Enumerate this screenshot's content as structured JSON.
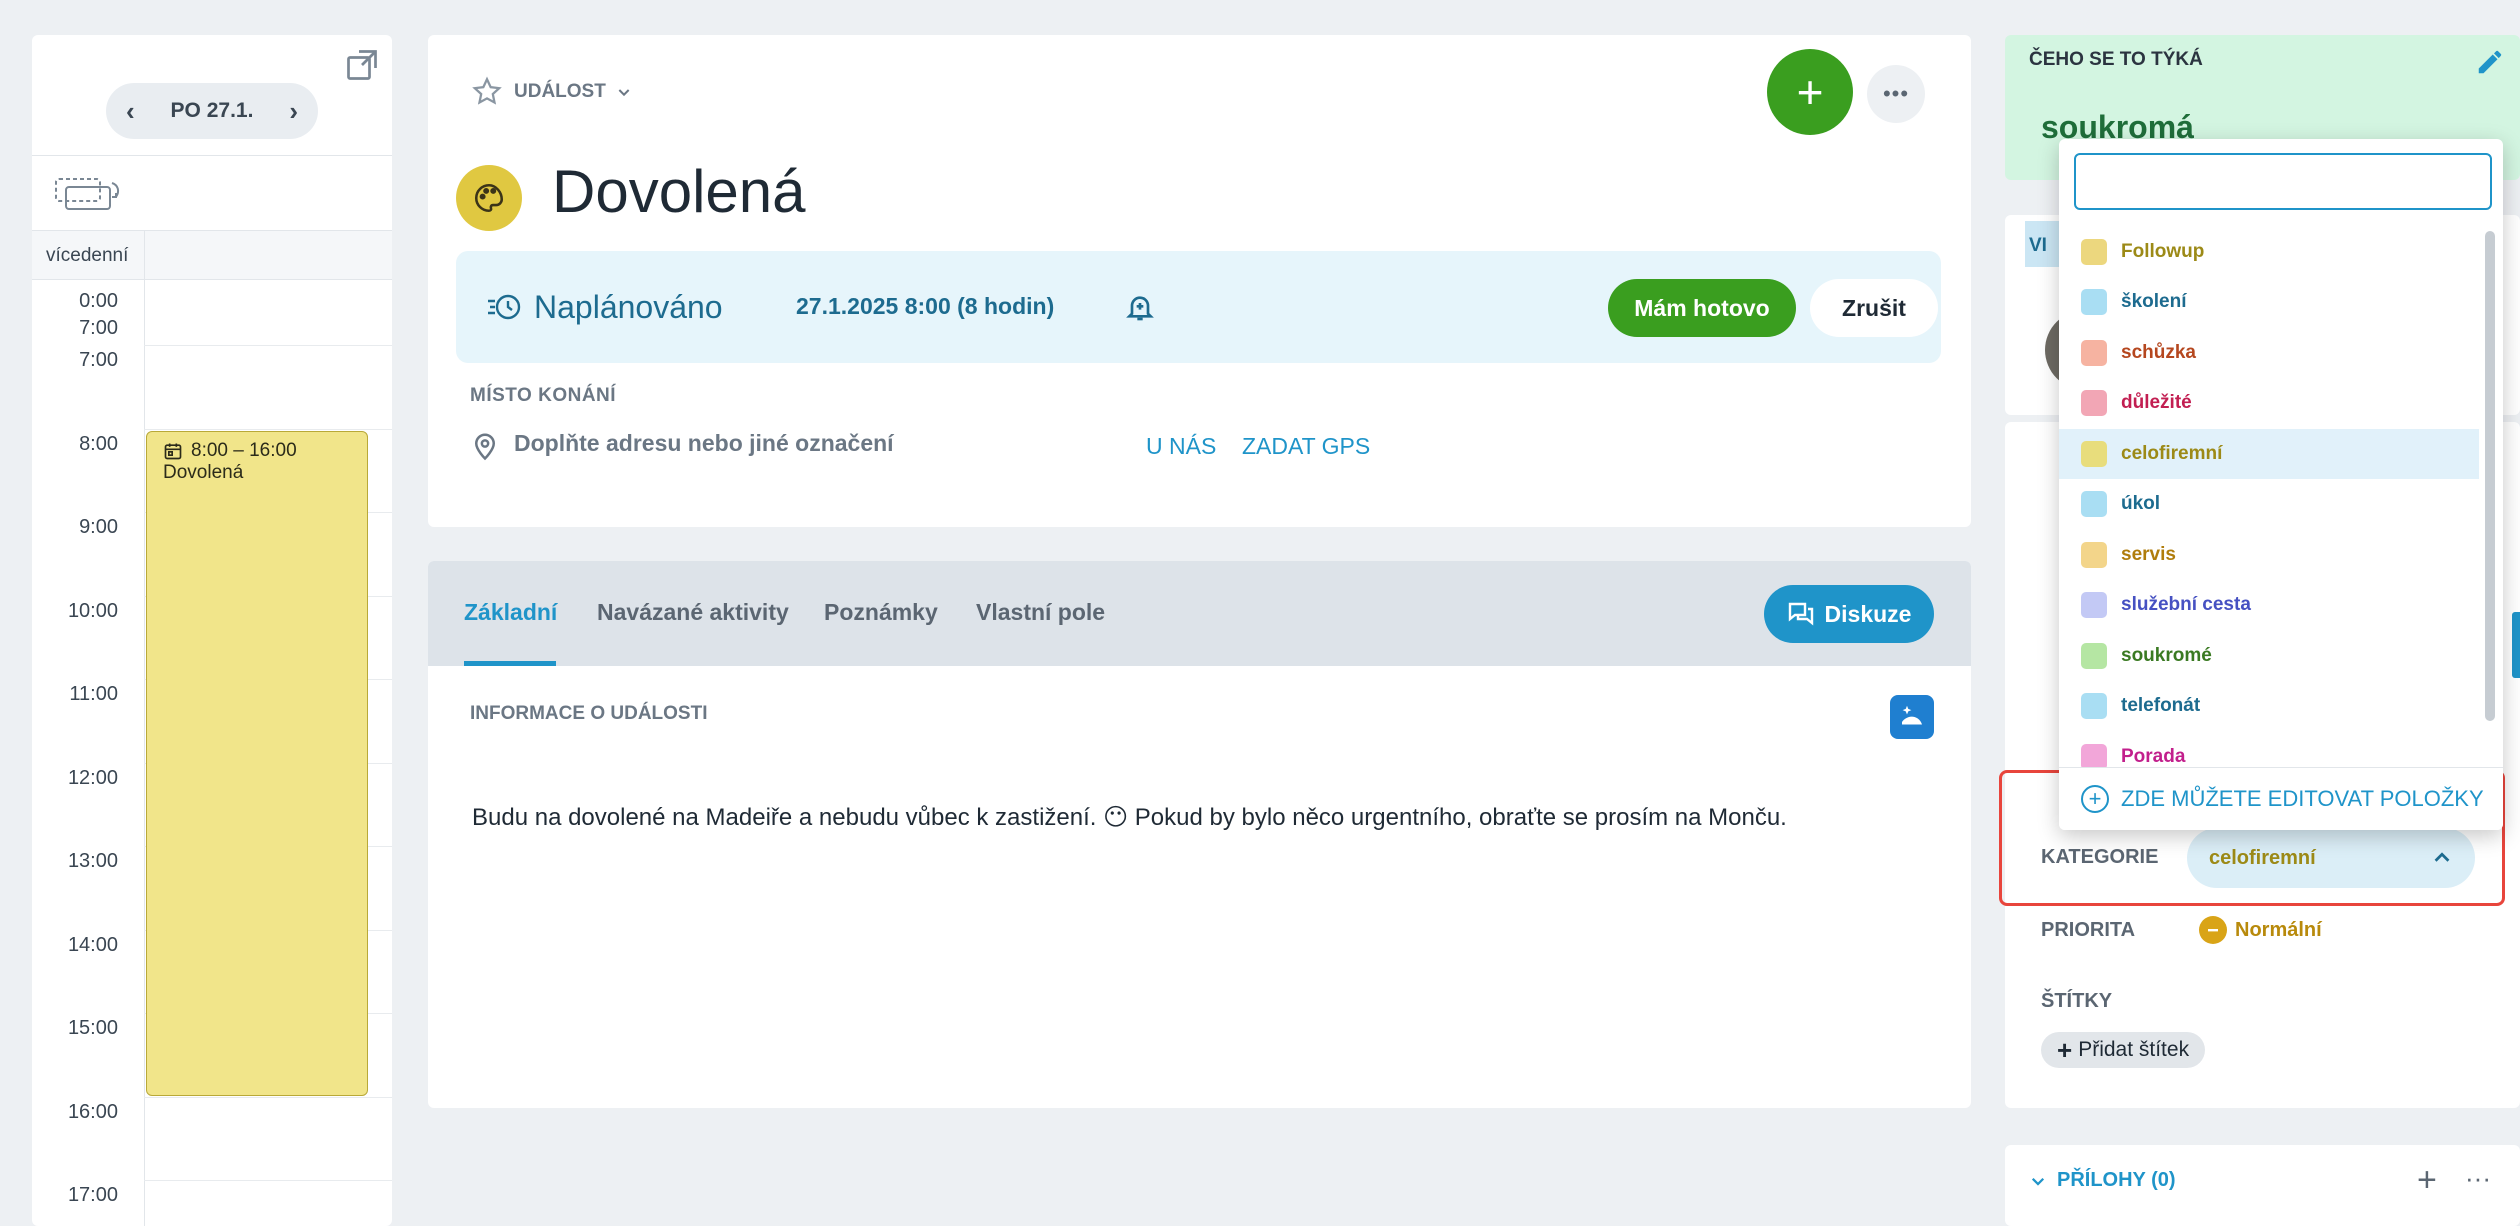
{
  "calendar": {
    "date_label": "PO 27.1.",
    "multiday_label": "vícedenní",
    "allday_times": [
      "0:00",
      "7:00"
    ],
    "hours": [
      "7:00",
      "8:00",
      "9:00",
      "10:00",
      "11:00",
      "12:00",
      "13:00",
      "14:00",
      "15:00",
      "16:00",
      "17:00"
    ],
    "event": {
      "time": "8:00 – 16:00",
      "title": "Dovolená"
    }
  },
  "event": {
    "type_label": "UDÁLOST",
    "title": "Dovolená",
    "status": "Naplánováno",
    "datetime": "27.1.2025 8:00 (8 hodin)",
    "done_button": "Mám hotovo",
    "cancel_button": "Zrušit",
    "location_label": "MÍSTO KONÁNÍ",
    "location_placeholder": "Doplňte adresu nebo jiné označení",
    "location_u_nas": "U NÁS",
    "location_gps": "ZADAT GPS"
  },
  "tabs": {
    "items": [
      {
        "label": "Základní"
      },
      {
        "label": "Navázané aktivity"
      },
      {
        "label": "Poznámky"
      },
      {
        "label": "Vlastní pole"
      }
    ],
    "discussion_button": "Diskuze",
    "info_label": "INFORMACE O UDÁLOSTI",
    "description": "Budu na dovolené na Madeiře a nebudu vůbec k zastižení. 😶 Pokud by bylo něco urgentního, obraťte se prosím na Monču."
  },
  "sidebar": {
    "about_label": "ČEHO SE TO TÝKÁ",
    "about_value": "soukromá",
    "badge_text": "VI",
    "category_label": "KATEGORIE",
    "category_value": "celofiremní",
    "priority_label": "PRIORITA",
    "priority_value": "Normální",
    "tags_label": "ŠTÍTKY",
    "add_tag": "Přidat štítek",
    "attachments_label": "PŘÍLOHY (0)"
  },
  "dropdown": {
    "search_value": "",
    "edit_items_label": "ZDE MŮŽETE EDITOVAT POLOŽKY",
    "items": [
      {
        "label": "Followup",
        "swatch": "#ecd77e",
        "text_color": "#9c8a17"
      },
      {
        "label": "školení",
        "swatch": "#a9def3",
        "text_color": "#1d6b8f"
      },
      {
        "label": "schůzka",
        "swatch": "#f6b3a1",
        "text_color": "#b5471f"
      },
      {
        "label": "důležité",
        "swatch": "#f2a6b5",
        "text_color": "#c21f52"
      },
      {
        "label": "celofiremní",
        "swatch": "#e8dd7c",
        "text_color": "#9c8a17",
        "selected": true
      },
      {
        "label": "úkol",
        "swatch": "#a9def3",
        "text_color": "#1d6b8f"
      },
      {
        "label": "servis",
        "swatch": "#f3d58a",
        "text_color": "#b07d0c"
      },
      {
        "label": "služební cesta",
        "swatch": "#c3c9f5",
        "text_color": "#4651c2"
      },
      {
        "label": "soukromé",
        "swatch": "#b5e6a3",
        "text_color": "#3a7a22"
      },
      {
        "label": "telefonát",
        "swatch": "#a9def3",
        "text_color": "#1d6b8f"
      },
      {
        "label": "Porada",
        "swatch": "#f2a6d9",
        "text_color": "#c21f8c"
      }
    ]
  },
  "colors": {
    "accent": "#1f94c9",
    "green": "#3a9e1f",
    "highlight_border": "#e8453c",
    "event_fill": "#f1e58a"
  }
}
